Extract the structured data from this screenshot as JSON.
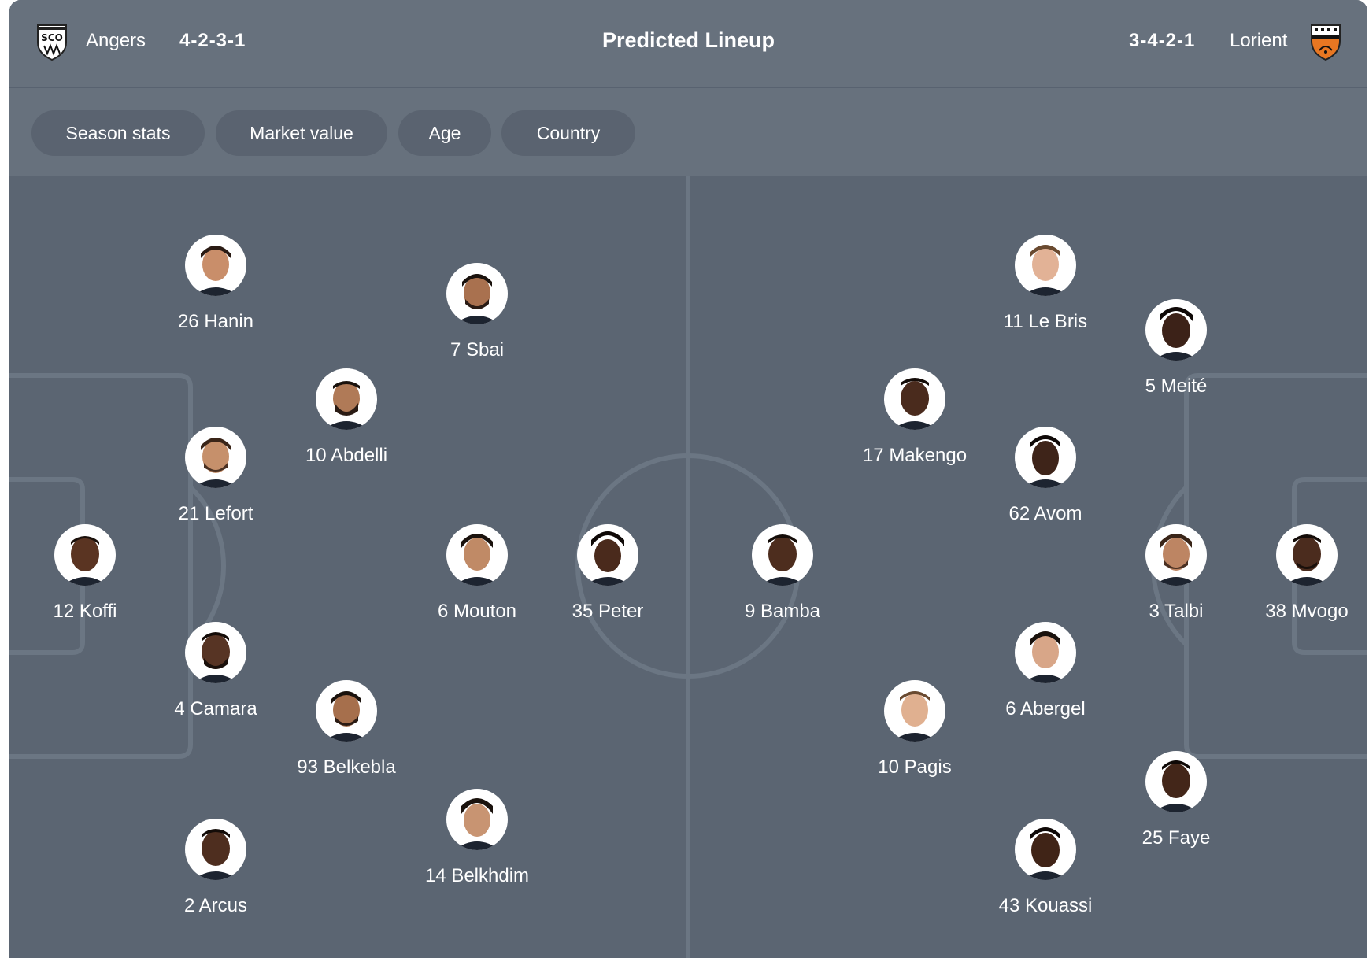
{
  "header": {
    "title": "Predicted Lineup",
    "home": {
      "name": "Angers",
      "formation": "4-2-3-1",
      "crest_icon": "angers-sco-crest-icon"
    },
    "away": {
      "name": "Lorient",
      "formation": "3-4-2-1",
      "crest_icon": "fc-lorient-crest-icon"
    }
  },
  "tabs": [
    {
      "label": "Season stats"
    },
    {
      "label": "Market value"
    },
    {
      "label": "Age"
    },
    {
      "label": "Country"
    }
  ],
  "colors": {
    "pitch": "#5b6572",
    "header": "#67717d",
    "tab": "#5a6370",
    "lines": "#6b7683",
    "text": "#ffffff",
    "lorient_orange": "#e87722"
  },
  "home_players": [
    {
      "label": "26 Hanin",
      "skin": "#c98e6a"
    },
    {
      "label": "7 Sbai",
      "skin": "#a9714f"
    },
    {
      "label": "10 Abdelli",
      "skin": "#b07a57"
    },
    {
      "label": "21 Lefort",
      "skin": "#c6906b"
    },
    {
      "label": "12 Koffi",
      "skin": "#5a3422"
    },
    {
      "label": "6 Mouton",
      "skin": "#c08a66"
    },
    {
      "label": "35 Peter",
      "skin": "#4a2a1c"
    },
    {
      "label": "4 Camara",
      "skin": "#573424"
    },
    {
      "label": "93 Belkebla",
      "skin": "#a66f4c"
    },
    {
      "label": "14 Belkhdim",
      "skin": "#c89472"
    },
    {
      "label": "2 Arcus",
      "skin": "#4e2e1f"
    }
  ],
  "away_players": [
    {
      "label": "9 Bamba",
      "skin": "#4d2d1e"
    },
    {
      "label": "11 Le Bris",
      "skin": "#e2b296"
    },
    {
      "label": "5 Meité",
      "skin": "#3c2218"
    },
    {
      "label": "17 Makengo",
      "skin": "#4a2b1d"
    },
    {
      "label": "62 Avom",
      "skin": "#3e2419"
    },
    {
      "label": "3 Talbi",
      "skin": "#bd8563"
    },
    {
      "label": "38 Mvogo",
      "skin": "#4b2c1e"
    },
    {
      "label": "6 Abergel",
      "skin": "#d8a688"
    },
    {
      "label": "10 Pagis",
      "skin": "#e0b090"
    },
    {
      "label": "25 Faye",
      "skin": "#432619"
    },
    {
      "label": "43 Kouassi",
      "skin": "#402417"
    }
  ]
}
